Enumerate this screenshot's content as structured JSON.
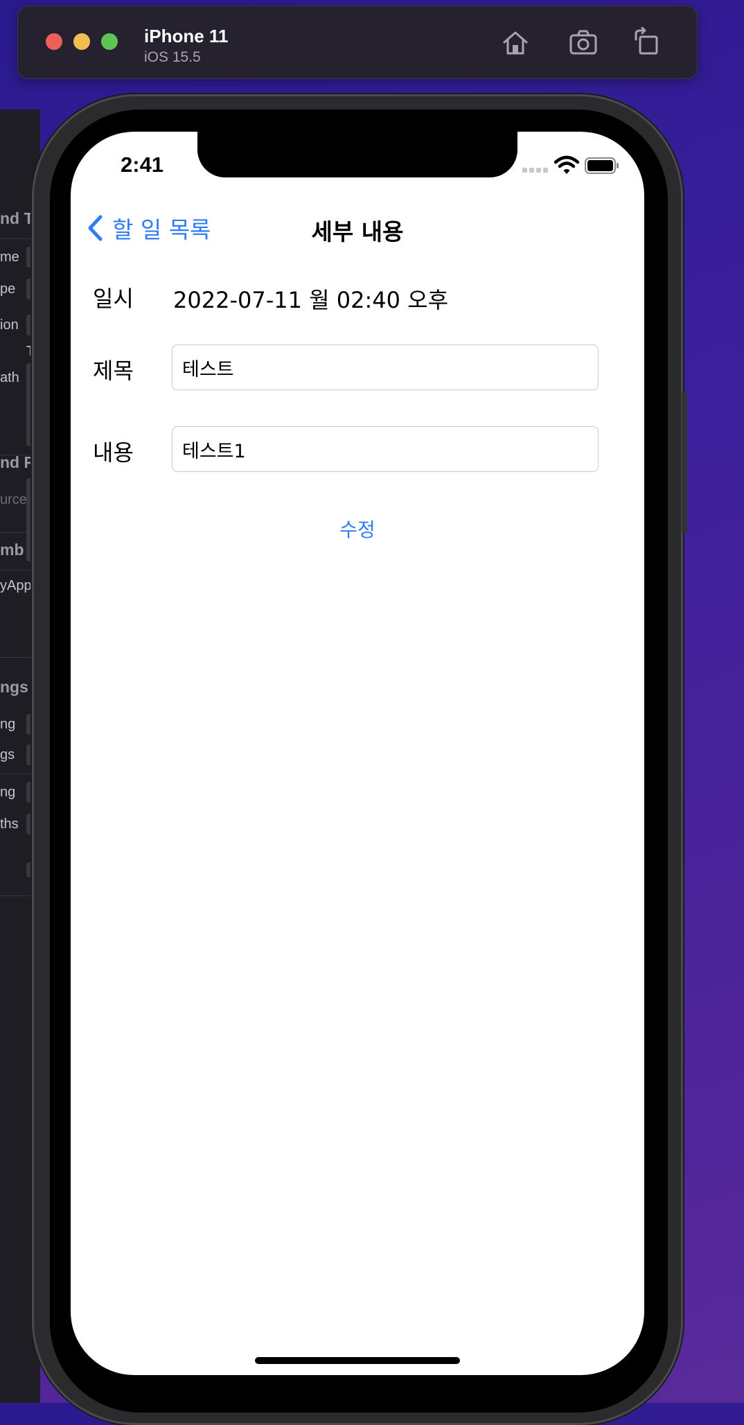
{
  "simulator": {
    "device_name": "iPhone 11",
    "os_version": "iOS 15.5",
    "icons": [
      "home-icon",
      "screenshot-camera-icon",
      "rotate-icon"
    ]
  },
  "xcode_panel": {
    "rows": [
      {
        "text": "nd T"
      },
      {
        "text": "me"
      },
      {
        "text": "pe"
      },
      {
        "text": "ion"
      },
      {
        "text": "T"
      },
      {
        "text": "ath"
      },
      {
        "text": "nd Re"
      },
      {
        "text": "urce"
      },
      {
        "text": "mb"
      },
      {
        "text": "yApp"
      },
      {
        "text": "ngs"
      },
      {
        "text": "ng"
      },
      {
        "text": "gs"
      },
      {
        "text": "ng"
      },
      {
        "text": "ths"
      }
    ]
  },
  "status_bar": {
    "time": "2:41"
  },
  "nav": {
    "back_label": "할 일 목록",
    "title": "세부 내용"
  },
  "form": {
    "date_label": "일시",
    "date_value": "2022-07-11 월 02:40 오후",
    "title_label": "제목",
    "title_value": "테스트",
    "content_label": "내용",
    "content_value": "테스트1",
    "edit_button": "수정"
  },
  "colors": {
    "accent": "#2f7cf6",
    "background": "#ffffff"
  }
}
